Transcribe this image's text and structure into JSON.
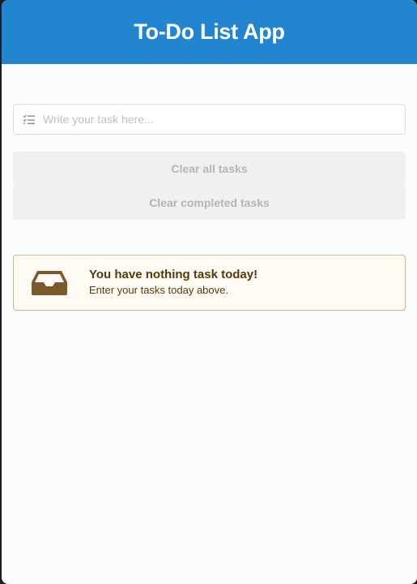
{
  "header": {
    "title": "To-Do List App"
  },
  "task_input": {
    "placeholder": "Write your task here...",
    "value": "",
    "icon": "task-list-icon"
  },
  "buttons": {
    "clear_all_label": "Clear all tasks",
    "clear_completed_label": "Clear completed tasks"
  },
  "empty_message": {
    "icon": "inbox-icon",
    "headline": "You have nothing task today!",
    "subtext": "Enter your tasks today above."
  },
  "colors": {
    "header_bg": "#2185d0",
    "message_text": "#573a08",
    "message_bg": "#fffaf3",
    "button_bg": "#eff0f1"
  }
}
